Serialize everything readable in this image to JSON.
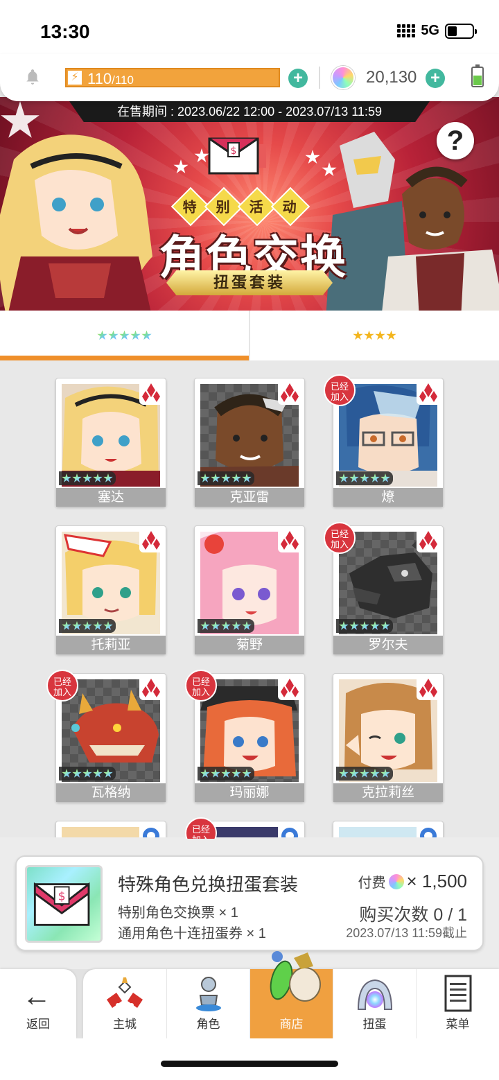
{
  "status_bar": {
    "time": "13:30",
    "network": "5G"
  },
  "resources": {
    "stamina_current": "110",
    "stamina_max": "/110",
    "gems": "20,130"
  },
  "banner": {
    "sale_period": "在售期间 : 2023.06/22 12:00 - 2023.07/13 11:59",
    "badges": [
      "特",
      "别",
      "活",
      "动"
    ],
    "title": "角色交换",
    "subtitle": "扭蛋套装"
  },
  "tabs": [
    {
      "label": "5-star rainbow",
      "stars": 5,
      "active": true
    },
    {
      "label": "4-star gold",
      "stars": 4,
      "active": false
    }
  ],
  "owned_label": "已经加入",
  "characters": [
    {
      "name": "塞达",
      "owned": false
    },
    {
      "name": "克亚雷",
      "owned": false
    },
    {
      "name": "燎",
      "owned": true
    },
    {
      "name": "托莉亚",
      "owned": false
    },
    {
      "name": "菊野",
      "owned": false
    },
    {
      "name": "罗尔夫",
      "owned": true
    },
    {
      "name": "瓦格纳",
      "owned": true
    },
    {
      "name": "玛丽娜",
      "owned": true
    },
    {
      "name": "克拉莉丝",
      "owned": false
    }
  ],
  "purchase": {
    "title": "特殊角色兑换扭蛋套装",
    "item1": "特别角色交换票 × 1",
    "item2": "通用角色十连扭蛋券 × 1",
    "price_label": "付费",
    "price_amount": "× 1,500",
    "count": "购买次数 0 / 1",
    "deadline": "2023.07/13 11:59截止"
  },
  "nav": {
    "back": "返回",
    "items": [
      "主城",
      "角色",
      "商店",
      "扭蛋",
      "菜单"
    ],
    "active": "商店"
  },
  "colors": {
    "accent": "#ef8f2a",
    "owned_badge": "#d8353e",
    "plus": "#42b89e"
  }
}
